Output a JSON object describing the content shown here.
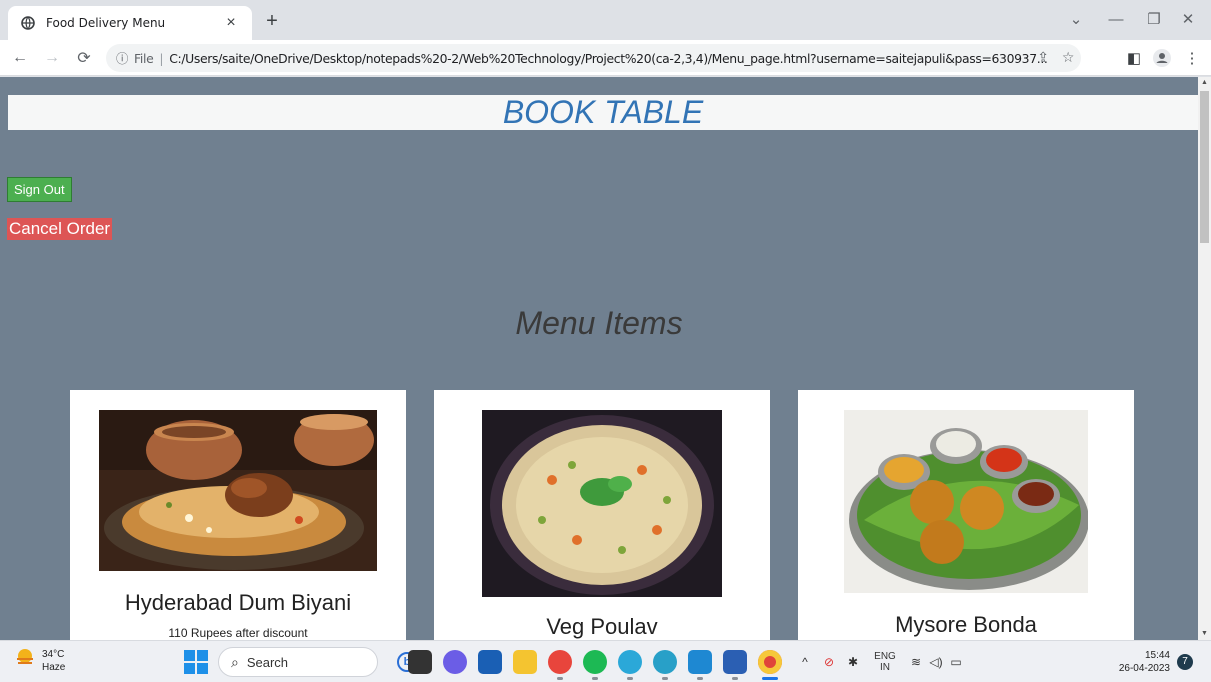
{
  "browser": {
    "tab_title": "Food Delivery Menu",
    "tab_close": "×",
    "new_tab": "+",
    "address": {
      "scheme": "File",
      "separator": "|",
      "url": "C:/Users/saite/OneDrive/Desktop/notepads%20-2/Web%20Technology/Project%20(ca-2,3,4)/Menu_page.html?username=saitejapuli&pass=630937..."
    }
  },
  "page": {
    "banner_title": "BOOK TABLE",
    "sign_out_label": "Sign Out",
    "cancel_order_label": "Cancel Order",
    "menu_heading": "Menu Items",
    "items": [
      {
        "name": "Hyderabad Dum Biyani",
        "price_note": "110 Rupees after discount"
      },
      {
        "name": "Veg Poulav"
      },
      {
        "name": "Mysore Bonda"
      }
    ]
  },
  "taskbar": {
    "weather_temp": "34°C",
    "weather_desc": "Haze",
    "search_label": "Search",
    "lang_top": "ENG",
    "lang_bottom": "IN",
    "time": "15:44",
    "date": "26-04-2023",
    "notification_count": "7"
  },
  "colors": {
    "page_background": "#708090",
    "banner_text": "#3274b5",
    "sign_out": "#4caf50",
    "cancel_order": "#dd5555"
  }
}
